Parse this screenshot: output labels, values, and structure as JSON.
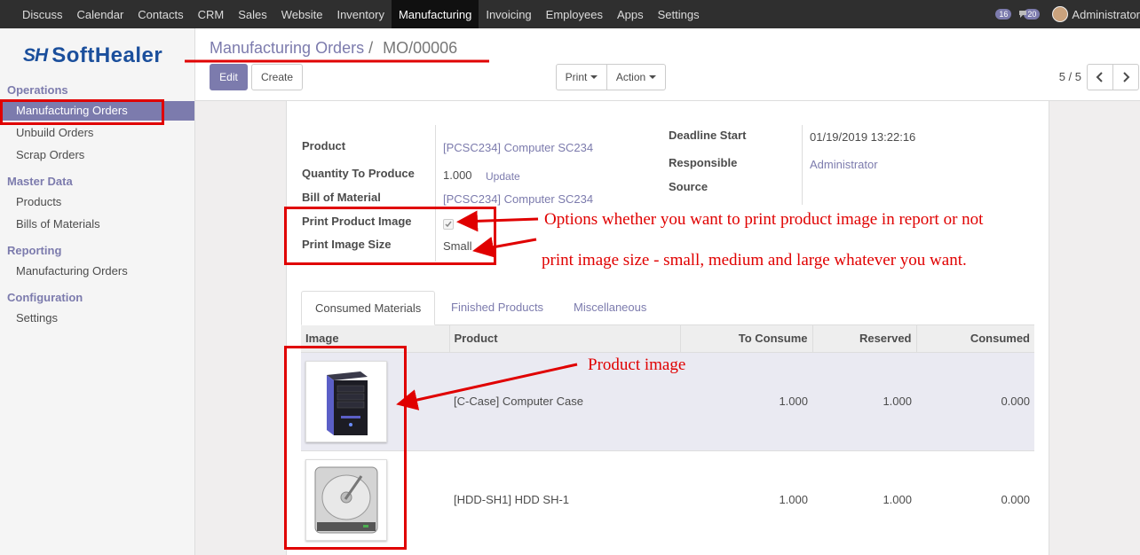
{
  "nav": {
    "items": [
      "Discuss",
      "Calendar",
      "Contacts",
      "CRM",
      "Sales",
      "Website",
      "Inventory",
      "Manufacturing",
      "Invoicing",
      "Employees",
      "Apps",
      "Settings"
    ],
    "active": "Manufacturing",
    "chat_count": "16",
    "msg_count": "20",
    "user": "Administrator"
  },
  "brand": {
    "mark": "SH",
    "word": "SoftHealer",
    "color": "#1b4f9c"
  },
  "sidebar": {
    "sections": [
      {
        "title": "Operations",
        "items": [
          "Manufacturing Orders",
          "Unbuild Orders",
          "Scrap Orders"
        ]
      },
      {
        "title": "Master Data",
        "items": [
          "Products",
          "Bills of Materials"
        ]
      },
      {
        "title": "Reporting",
        "items": [
          "Manufacturing Orders"
        ]
      },
      {
        "title": "Configuration",
        "items": [
          "Settings"
        ]
      }
    ],
    "active_item": "Manufacturing Orders"
  },
  "breadcrumb": {
    "parent": "Manufacturing Orders",
    "separator": "/",
    "current": "MO/00006"
  },
  "buttons": {
    "edit": "Edit",
    "create": "Create",
    "print": "Print",
    "action": "Action"
  },
  "pager": {
    "text": "5 / 5"
  },
  "form": {
    "product_label": "Product",
    "product_value": "[PCSC234] Computer SC234",
    "qty_label": "Quantity To Produce",
    "qty_value": "1.000",
    "qty_update": "Update",
    "bom_label": "Bill of Material",
    "bom_value": "[PCSC234] Computer SC234",
    "print_image_label": "Print Product Image",
    "print_image_checked": true,
    "image_size_label": "Print Image Size",
    "image_size_value": "Small",
    "deadline_label": "Deadline Start",
    "deadline_value": "01/19/2019 13:22:16",
    "responsible_label": "Responsible",
    "responsible_value": "Administrator",
    "source_label": "Source",
    "source_value": ""
  },
  "tabs": [
    "Consumed Materials",
    "Finished Products",
    "Miscellaneous"
  ],
  "table": {
    "headers": [
      "Image",
      "Product",
      "To Consume",
      "Reserved",
      "Consumed"
    ],
    "rows": [
      {
        "image": "computer-case",
        "product": "[C-Case] Computer Case",
        "to_consume": "1.000",
        "reserved": "1.000",
        "consumed": "0.000"
      },
      {
        "image": "hard-disk",
        "product": "[HDD-SH1] HDD SH-1",
        "to_consume": "1.000",
        "reserved": "1.000",
        "consumed": "0.000"
      }
    ]
  },
  "annotations": {
    "options_note": "Options whether you want to print product image in report or not",
    "size_note": "print image size - small, medium and large whatever you want.",
    "image_note": "Product image",
    "color": "#e00000"
  },
  "colors": {
    "accent": "#7c7bad",
    "navbar": "#2f2f2f"
  }
}
